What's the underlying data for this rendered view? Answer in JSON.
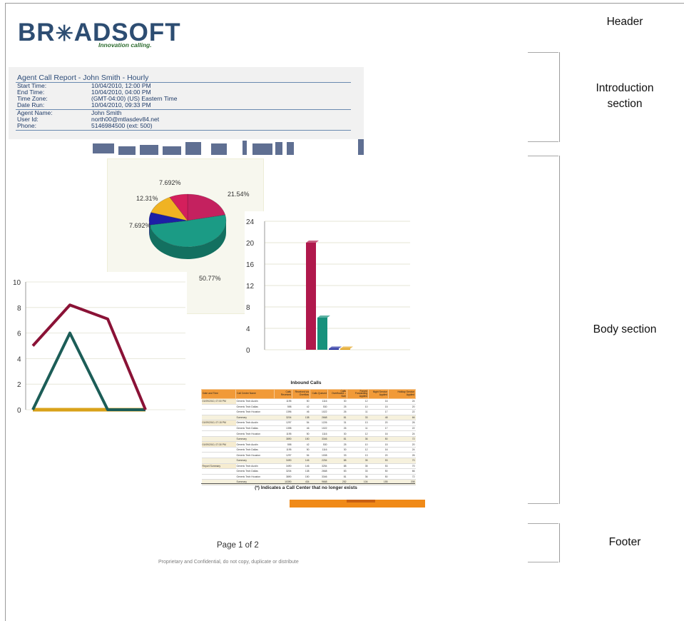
{
  "logo": {
    "wordmark_left": "BR",
    "wordmark_star": "✳",
    "wordmark_right": "ADSOFT",
    "tagline": "Innovation calling."
  },
  "report": {
    "title": "Agent Call Report - John Smith - Hourly",
    "fields": [
      {
        "label": "Start Time:",
        "value": "10/04/2010, 12:00 PM"
      },
      {
        "label": "End Time:",
        "value": "10/04/2010, 04:00 PM"
      },
      {
        "label": "Time Zone:",
        "value": "(GMT-04:00) (US) Eastern Time"
      },
      {
        "label": "Date Run:",
        "value": "10/04/2010, 09:33 PM"
      },
      {
        "label": "Agent Name:",
        "value": "John Smith"
      },
      {
        "label": "User Id:",
        "value": "north00@mtlasdev84.net"
      },
      {
        "label": "Phone:",
        "value": "5146984500 (ext: 500)"
      }
    ]
  },
  "chart_data": [
    {
      "type": "pie",
      "slices": [
        {
          "label": "21.54%",
          "value": 21.54,
          "color": "#c4215f"
        },
        {
          "label": "50.77%",
          "value": 50.77,
          "color": "#1b9b85"
        },
        {
          "label": "7.692%",
          "value": 7.692,
          "color": "#1d1fa6"
        },
        {
          "label": "12.31%",
          "value": 12.31,
          "color": "#f0b323"
        },
        {
          "label": "7.692%",
          "value": 7.692,
          "color": "#d41f5c"
        }
      ]
    },
    {
      "type": "bar",
      "yticks": [
        "0",
        "4",
        "8",
        "12",
        "16",
        "20",
        "24"
      ],
      "ylim": [
        0,
        24
      ],
      "values": [
        20,
        6,
        0.2,
        0.2
      ],
      "colors": [
        "#b0184c",
        "#17917c",
        "#1e2a9e",
        "#e2a21b"
      ]
    },
    {
      "type": "line",
      "yticks": [
        "0",
        "2",
        "4",
        "6",
        "8",
        "10"
      ],
      "ylim": [
        0,
        10
      ],
      "series": [
        {
          "values": [
            5,
            8.2,
            7.1,
            0
          ],
          "color": "#8a1236"
        },
        {
          "values": [
            0,
            6,
            0,
            0
          ],
          "color": "#1c5d57"
        },
        {
          "values": [
            0,
            0,
            0,
            0
          ],
          "color": "#d9a21a"
        }
      ]
    }
  ],
  "table": {
    "title": "Inbound Calls",
    "headers": [
      "Date and Time",
      "Call Center Name",
      "Calls Received",
      "Received via Overflow",
      "Calls Queued",
      "Calls Overflowed – Size",
      "Forced Forwarding Applied",
      "Night Service Applied",
      "Holiday Service Applied"
    ],
    "rows": [
      [
        "01/09/2010, 07:00 PM",
        "Generic Tech Austin",
        "1195",
        "50",
        "1116",
        "30",
        "12",
        "16",
        "24"
      ],
      [
        "",
        "Generic Tech Dallas",
        "598",
        "42",
        "530",
        "25",
        "10",
        "15",
        "20"
      ],
      [
        "",
        "Generic Tech Houston",
        "1396",
        "46",
        "1022",
        "26",
        "11",
        "17",
        "22"
      ],
      [
        "",
        "Summary",
        "3204",
        "138",
        "2668",
        "81",
        "33",
        "48",
        "66"
      ],
      [
        "01/09/2010, 07:15 PM",
        "Generic Tech Austin",
        "1297",
        "54",
        "1226",
        "31",
        "13",
        "20",
        "26"
      ],
      [
        "",
        "Generic Tech Dallas",
        "1398",
        "46",
        "1022",
        "26",
        "11",
        "17",
        "22"
      ],
      [
        "",
        "Generic Tech Houston",
        "1195",
        "50",
        "1116",
        "30",
        "12",
        "16",
        "24"
      ],
      [
        "",
        "Summary",
        "3890",
        "150",
        "3346",
        "81",
        "36",
        "50",
        "72"
      ],
      [
        "01/09/2010, 07:30 PM",
        "Generic Tech Austin",
        "598",
        "42",
        "530",
        "25",
        "10",
        "15",
        "20"
      ],
      [
        "",
        "Generic Tech Dallas",
        "1195",
        "50",
        "1116",
        "30",
        "12",
        "16",
        "24"
      ],
      [
        "",
        "Generic Tech Houston",
        "1297",
        "54",
        "1008",
        "33",
        "13",
        "20",
        "26"
      ],
      [
        "",
        "Summary",
        "3490",
        "146",
        "2254",
        "88",
        "35",
        "53",
        "70"
      ],
      [
        "Report Summary",
        "Generic Tech Austin",
        "3490",
        "146",
        "3254",
        "88",
        "35",
        "53",
        "70"
      ],
      [
        "",
        "Generic Tech Dallas",
        "3204",
        "138",
        "2668",
        "83",
        "33",
        "50",
        "66"
      ],
      [
        "",
        "Generic Tech Houston",
        "3890",
        "150",
        "3346",
        "81",
        "36",
        "50",
        "72"
      ],
      [
        "",
        "Summary",
        "10390",
        "434",
        "9668",
        "252",
        "104",
        "155",
        "208"
      ]
    ],
    "footnote": "(*) Indicates a Call Center that no longer exists"
  },
  "footer": {
    "page": "Page 1 of 2",
    "confidential": "Proprietary and Confidential, do not copy, duplicate or distribute"
  },
  "annotations": {
    "header": "Header",
    "intro": "Introduction section",
    "body": "Body section",
    "footer": "Footer"
  }
}
